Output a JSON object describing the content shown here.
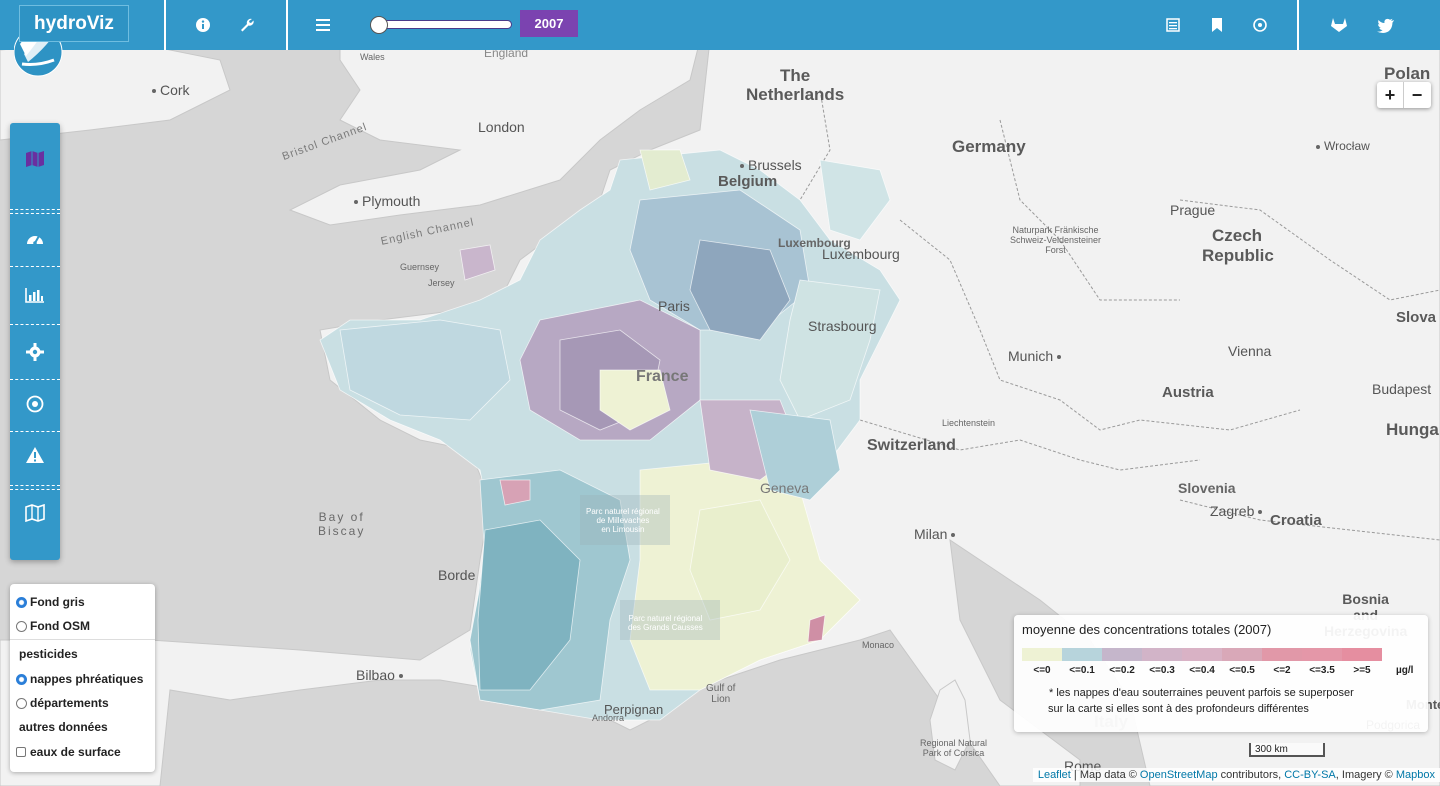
{
  "app": {
    "logo_text": "hydroViz",
    "year": "2007",
    "slider_progress": 0.0
  },
  "topbar_icons": {
    "info": "info-icon",
    "tools": "wrench-icon",
    "menu": "menu-icon",
    "doc": "document-icon",
    "bookmark": "bookmark-icon",
    "target": "target-icon",
    "gitlab": "gitlab-icon",
    "twitter": "twitter-icon"
  },
  "sidenav_icons": [
    "map-filled-icon",
    "dashboard-icon",
    "bar-chart-icon",
    "gear-icon",
    "dot-circle-icon",
    "warning-icon",
    "map-outline-icon"
  ],
  "zoom": {
    "in": "+",
    "out": "−"
  },
  "layers": {
    "base": [
      {
        "label": "Fond gris",
        "checked": true
      },
      {
        "label": "Fond OSM",
        "checked": false
      }
    ],
    "pesticides_title": "pesticides",
    "pesticides": [
      {
        "label": "nappes phréatiques",
        "checked": true
      },
      {
        "label": "départements",
        "checked": false
      }
    ],
    "other_title": "autres données",
    "other": [
      {
        "label": "eaux de surface",
        "checked": false
      }
    ]
  },
  "legend": {
    "title": "moyenne des concentrations totales (2007)",
    "classes": [
      {
        "label": "<=0",
        "color": "#eef2d4"
      },
      {
        "label": "<=0.1",
        "color": "#b7d4dc"
      },
      {
        "label": "<=0.2",
        "color": "#c5b6cb"
      },
      {
        "label": "<=0.3",
        "color": "#d2b4c8"
      },
      {
        "label": "<=0.4",
        "color": "#d9b2c5"
      },
      {
        "label": "<=0.5",
        "color": "#d9a8b8"
      },
      {
        "label": "<=2",
        "color": "#e198a8"
      },
      {
        "label": "<=3.5",
        "color": "#e497a8"
      },
      {
        "label": ">=5",
        "color": "#e58ea0"
      }
    ],
    "unit": "µg/l",
    "note_line1": "* les nappes d'eau souterraines peuvent parfois se superposer",
    "note_line2": "sur la carte si elles sont à des profondeurs différentes"
  },
  "scale_label": "300 km",
  "attribution": {
    "leaflet": "Leaflet",
    "sep": " | Map data © ",
    "osm": "OpenStreetMap",
    "contrib": " contributors, ",
    "license": "CC-BY-SA",
    "imagery": ", Imagery © ",
    "mapbox": "Mapbox"
  },
  "map_labels": {
    "wales": "Wales",
    "england": "England",
    "cork": "Cork",
    "bristol_channel": "Bristol Channel",
    "london": "London",
    "plymouth": "Plymouth",
    "english_channel": "English Channel",
    "guernsey": "Guernsey",
    "jersey": "Jersey",
    "netherlands1": "The",
    "netherlands2": "Netherlands",
    "brussels": "Brussels",
    "belgium": "Belgium",
    "luxembourg_country": "Luxembourg",
    "luxembourg_city": "Luxembourg",
    "germany": "Germany",
    "poland": "Polan",
    "wroclaw": "Wrocław",
    "prague": "Prague",
    "saxon1": "Naturpark Fränkische",
    "saxon2": "Schweiz-Veldensteiner",
    "saxon3": "Forst",
    "czech1": "Czech",
    "czech2": "Republic",
    "slovakia": "Slova",
    "paris": "Paris",
    "strasbourg": "Strasbourg",
    "munich": "Munich",
    "vienna": "Vienna",
    "austria": "Austria",
    "budapest": "Budapest",
    "hungary": "Hunga",
    "liechtenstein": "Liechtenstein",
    "switzerland": "Switzerland",
    "france": "France",
    "geneva": "Geneva",
    "slovenia": "Slovenia",
    "zagreb": "Zagreb",
    "croatia": "Croatia",
    "milan": "Milan",
    "bosnia1": "Bosnia",
    "bosnia2": "and",
    "bosnia3": "Herzegovina",
    "montenegro": "Montene",
    "podgorica": "Podgorica",
    "bay1": "Bay of",
    "bay2": "Biscay",
    "bordeaux": "Borde",
    "bilbao": "Bilbao",
    "monaco": "Monaco",
    "gulf1": "Gulf of",
    "gulf2": "Lion",
    "perpignan": "Perpignan",
    "andorra": "Andorra",
    "italy": "Italy",
    "rome": "Rome",
    "corsica1": "Regional Natural",
    "corsica2": "Park of Corsica",
    "park_millevaches1": "Parc naturel régional",
    "park_millevaches2": "de Millevaches",
    "park_millevaches3": "en Limousin",
    "park_causses1": "Parc naturel régional",
    "park_causses2": "des Grands Causses"
  }
}
